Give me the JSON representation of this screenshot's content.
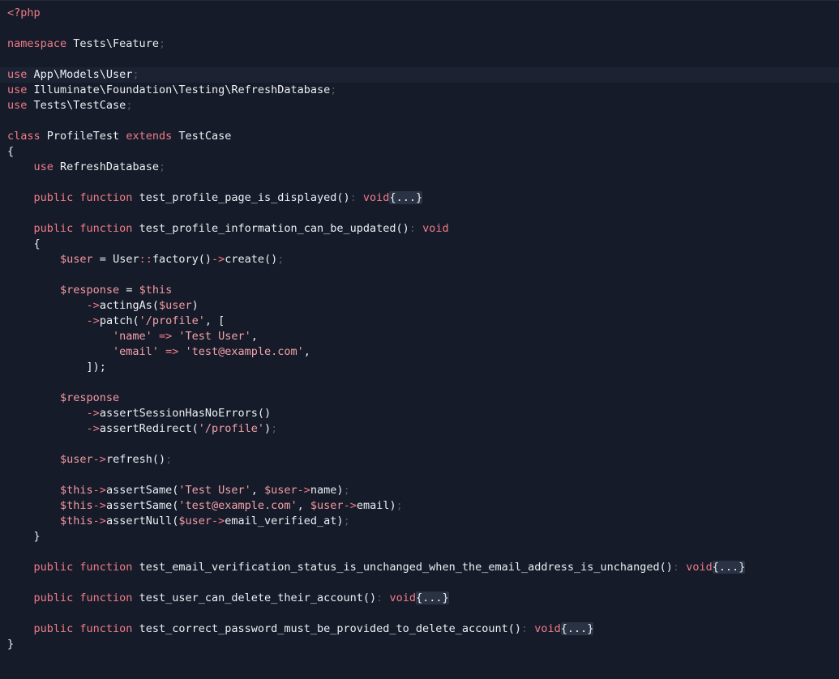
{
  "editor": {
    "language": "php",
    "current_line": 5,
    "lines": [
      {
        "tokens": [
          {
            "t": "<?php",
            "k": "kw"
          }
        ]
      },
      {
        "tokens": []
      },
      {
        "tokens": [
          {
            "t": "namespace",
            "k": "kw"
          },
          {
            "t": " Tests\\Feature",
            "k": "id"
          },
          {
            "t": ";",
            "k": "semi"
          }
        ]
      },
      {
        "tokens": []
      },
      {
        "tokens": [
          {
            "t": "use",
            "k": "kw"
          },
          {
            "t": " App\\Models\\User",
            "k": "id"
          },
          {
            "t": ";",
            "k": "semi"
          }
        ]
      },
      {
        "tokens": [
          {
            "t": "use",
            "k": "kw"
          },
          {
            "t": " Illuminate\\Foundation\\Testing\\RefreshDatabase",
            "k": "id"
          },
          {
            "t": ";",
            "k": "semi"
          }
        ]
      },
      {
        "tokens": [
          {
            "t": "use",
            "k": "kw"
          },
          {
            "t": " Tests\\TestCase",
            "k": "id"
          },
          {
            "t": ";",
            "k": "semi"
          }
        ]
      },
      {
        "tokens": []
      },
      {
        "tokens": [
          {
            "t": "class",
            "k": "kw"
          },
          {
            "t": " ProfileTest ",
            "k": "id"
          },
          {
            "t": "extends",
            "k": "kw"
          },
          {
            "t": " TestCase",
            "k": "id"
          }
        ]
      },
      {
        "tokens": [
          {
            "t": "{",
            "k": "punc"
          }
        ]
      },
      {
        "tokens": [
          {
            "t": "    ",
            "k": "id"
          },
          {
            "t": "use",
            "k": "kw"
          },
          {
            "t": " RefreshDatabase",
            "k": "id"
          },
          {
            "t": ";",
            "k": "semi"
          }
        ]
      },
      {
        "tokens": []
      },
      {
        "tokens": [
          {
            "t": "    ",
            "k": "id"
          },
          {
            "t": "public function",
            "k": "kw"
          },
          {
            "t": " test_profile_page_is_displayed()",
            "k": "id"
          },
          {
            "t": ": ",
            "k": "semi"
          },
          {
            "t": "void",
            "k": "kw"
          },
          {
            "t": "{...}",
            "k": "fold"
          }
        ]
      },
      {
        "tokens": []
      },
      {
        "tokens": [
          {
            "t": "    ",
            "k": "id"
          },
          {
            "t": "public function",
            "k": "kw"
          },
          {
            "t": " test_profile_information_can_be_updated()",
            "k": "id"
          },
          {
            "t": ": ",
            "k": "semi"
          },
          {
            "t": "void",
            "k": "kw"
          }
        ]
      },
      {
        "tokens": [
          {
            "t": "    {",
            "k": "punc"
          }
        ]
      },
      {
        "tokens": [
          {
            "t": "        ",
            "k": "id"
          },
          {
            "t": "$user",
            "k": "var"
          },
          {
            "t": " = ",
            "k": "id"
          },
          {
            "t": "User",
            "k": "id"
          },
          {
            "t": "::",
            "k": "op"
          },
          {
            "t": "factory()",
            "k": "id"
          },
          {
            "t": "->",
            "k": "op"
          },
          {
            "t": "create()",
            "k": "id"
          },
          {
            "t": ";",
            "k": "semi"
          }
        ]
      },
      {
        "tokens": []
      },
      {
        "tokens": [
          {
            "t": "        ",
            "k": "id"
          },
          {
            "t": "$response",
            "k": "var"
          },
          {
            "t": " = ",
            "k": "id"
          },
          {
            "t": "$this",
            "k": "var"
          }
        ]
      },
      {
        "tokens": [
          {
            "t": "            ",
            "k": "id"
          },
          {
            "t": "->",
            "k": "op"
          },
          {
            "t": "actingAs(",
            "k": "id"
          },
          {
            "t": "$user",
            "k": "var"
          },
          {
            "t": ")",
            "k": "id"
          }
        ]
      },
      {
        "tokens": [
          {
            "t": "            ",
            "k": "id"
          },
          {
            "t": "->",
            "k": "op"
          },
          {
            "t": "patch(",
            "k": "id"
          },
          {
            "t": "'/profile'",
            "k": "str"
          },
          {
            "t": ", [",
            "k": "id"
          }
        ]
      },
      {
        "tokens": [
          {
            "t": "                ",
            "k": "id"
          },
          {
            "t": "'name'",
            "k": "str"
          },
          {
            "t": " => ",
            "k": "op"
          },
          {
            "t": "'Test User'",
            "k": "str"
          },
          {
            "t": ",",
            "k": "id"
          }
        ]
      },
      {
        "tokens": [
          {
            "t": "                ",
            "k": "id"
          },
          {
            "t": "'email'",
            "k": "str"
          },
          {
            "t": " => ",
            "k": "op"
          },
          {
            "t": "'test@example.com'",
            "k": "str"
          },
          {
            "t": ",",
            "k": "id"
          }
        ]
      },
      {
        "tokens": [
          {
            "t": "            ]);",
            "k": "id"
          }
        ]
      },
      {
        "tokens": []
      },
      {
        "tokens": [
          {
            "t": "        ",
            "k": "id"
          },
          {
            "t": "$response",
            "k": "var"
          }
        ]
      },
      {
        "tokens": [
          {
            "t": "            ",
            "k": "id"
          },
          {
            "t": "->",
            "k": "op"
          },
          {
            "t": "assertSessionHasNoErrors()",
            "k": "id"
          }
        ]
      },
      {
        "tokens": [
          {
            "t": "            ",
            "k": "id"
          },
          {
            "t": "->",
            "k": "op"
          },
          {
            "t": "assertRedirect(",
            "k": "id"
          },
          {
            "t": "'/profile'",
            "k": "str"
          },
          {
            "t": ")",
            "k": "id"
          },
          {
            "t": ";",
            "k": "semi"
          }
        ]
      },
      {
        "tokens": []
      },
      {
        "tokens": [
          {
            "t": "        ",
            "k": "id"
          },
          {
            "t": "$user",
            "k": "var"
          },
          {
            "t": "->",
            "k": "op"
          },
          {
            "t": "refresh()",
            "k": "id"
          },
          {
            "t": ";",
            "k": "semi"
          }
        ]
      },
      {
        "tokens": []
      },
      {
        "tokens": [
          {
            "t": "        ",
            "k": "id"
          },
          {
            "t": "$this",
            "k": "var"
          },
          {
            "t": "->",
            "k": "op"
          },
          {
            "t": "assertSame(",
            "k": "id"
          },
          {
            "t": "'Test User'",
            "k": "str"
          },
          {
            "t": ", ",
            "k": "id"
          },
          {
            "t": "$user",
            "k": "var"
          },
          {
            "t": "->",
            "k": "op"
          },
          {
            "t": "name)",
            "k": "id"
          },
          {
            "t": ";",
            "k": "semi"
          }
        ]
      },
      {
        "tokens": [
          {
            "t": "        ",
            "k": "id"
          },
          {
            "t": "$this",
            "k": "var"
          },
          {
            "t": "->",
            "k": "op"
          },
          {
            "t": "assertSame(",
            "k": "id"
          },
          {
            "t": "'test@example.com'",
            "k": "str"
          },
          {
            "t": ", ",
            "k": "id"
          },
          {
            "t": "$user",
            "k": "var"
          },
          {
            "t": "->",
            "k": "op"
          },
          {
            "t": "email)",
            "k": "id"
          },
          {
            "t": ";",
            "k": "semi"
          }
        ]
      },
      {
        "tokens": [
          {
            "t": "        ",
            "k": "id"
          },
          {
            "t": "$this",
            "k": "var"
          },
          {
            "t": "->",
            "k": "op"
          },
          {
            "t": "assertNull(",
            "k": "id"
          },
          {
            "t": "$user",
            "k": "var"
          },
          {
            "t": "->",
            "k": "op"
          },
          {
            "t": "email_verified_at)",
            "k": "id"
          },
          {
            "t": ";",
            "k": "semi"
          }
        ]
      },
      {
        "tokens": [
          {
            "t": "    }",
            "k": "punc"
          }
        ]
      },
      {
        "tokens": []
      },
      {
        "tokens": [
          {
            "t": "    ",
            "k": "id"
          },
          {
            "t": "public function",
            "k": "kw"
          },
          {
            "t": " test_email_verification_status_is_unchanged_when_the_email_address_is_unchanged()",
            "k": "id"
          },
          {
            "t": ": ",
            "k": "semi"
          },
          {
            "t": "void",
            "k": "kw"
          },
          {
            "t": "{...}",
            "k": "fold"
          }
        ]
      },
      {
        "tokens": []
      },
      {
        "tokens": [
          {
            "t": "    ",
            "k": "id"
          },
          {
            "t": "public function",
            "k": "kw"
          },
          {
            "t": " test_user_can_delete_their_account()",
            "k": "id"
          },
          {
            "t": ": ",
            "k": "semi"
          },
          {
            "t": "void",
            "k": "kw"
          },
          {
            "t": "{...}",
            "k": "fold"
          }
        ]
      },
      {
        "tokens": []
      },
      {
        "tokens": [
          {
            "t": "    ",
            "k": "id"
          },
          {
            "t": "public function",
            "k": "kw"
          },
          {
            "t": " test_correct_password_must_be_provided_to_delete_account()",
            "k": "id"
          },
          {
            "t": ": ",
            "k": "semi"
          },
          {
            "t": "void",
            "k": "kw"
          },
          {
            "t": "{...}",
            "k": "fold"
          }
        ]
      },
      {
        "tokens": [
          {
            "t": "}",
            "k": "punc"
          }
        ]
      }
    ]
  },
  "colors": {
    "background": "#161b29",
    "keyword": "#f07c88",
    "identifier": "#eceff4",
    "string": "#f3a2aa",
    "variable": "#f49aa3",
    "muted_punctuation": "#4d5568",
    "fold_badge": "#2a3344",
    "current_line": "#1b2232"
  }
}
